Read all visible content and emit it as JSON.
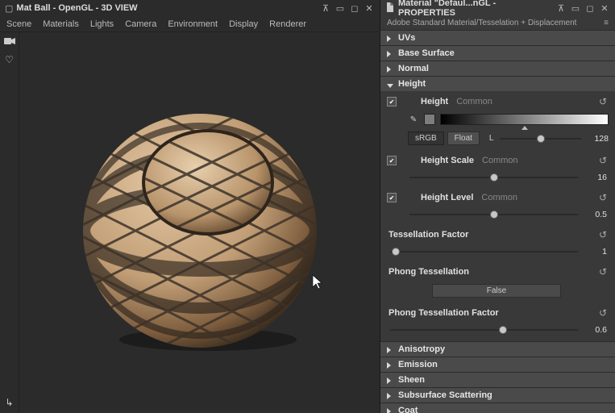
{
  "left_panel": {
    "title": "Mat Ball - OpenGL - 3D VIEW",
    "menu": [
      "Scene",
      "Materials",
      "Lights",
      "Camera",
      "Environment",
      "Display",
      "Renderer"
    ]
  },
  "right_panel": {
    "title": "Material \"Defaul...nGL - PROPERTIES",
    "subhead": "Adobe Standard Material/Tesselation + Displacement",
    "sections": {
      "uvs": "UVs",
      "base": "Base Surface",
      "normal": "Normal",
      "height": "Height",
      "anisotropy": "Anisotropy",
      "emission": "Emission",
      "sheen": "Sheen",
      "sss": "Subsurface Scattering",
      "coat": "Coat"
    },
    "height": {
      "label": "Height",
      "common": "Common",
      "srgb": "sRGB",
      "float": "Float",
      "L": "L",
      "Lvalue": "128",
      "scale": {
        "label": "Height Scale",
        "value": "16"
      },
      "level": {
        "label": "Height Level",
        "value": "0.5"
      },
      "tess": {
        "label": "Tessellation Factor",
        "value": "1"
      },
      "phong": {
        "label": "Phong Tessellation",
        "value": "False"
      },
      "ptf": {
        "label": "Phong Tessellation Factor",
        "value": "0.6"
      }
    }
  }
}
